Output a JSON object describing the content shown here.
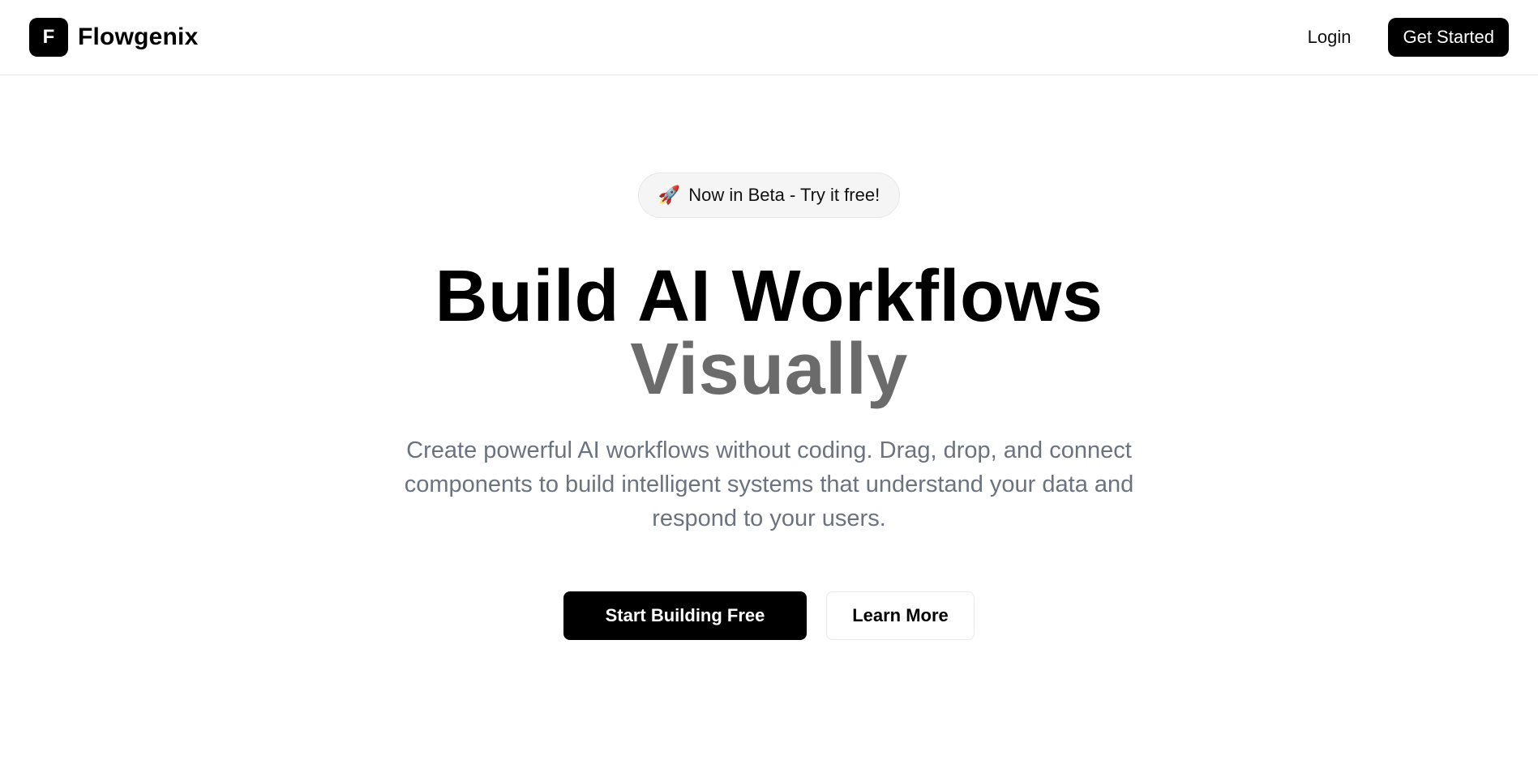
{
  "navbar": {
    "logo_letter": "F",
    "brand_name": "Flowgenix",
    "login_label": "Login",
    "get_started_label": "Get Started"
  },
  "hero": {
    "badge_icon": "rocket-icon",
    "badge_emoji": "🚀",
    "badge_text": "Now in Beta - Try it free!",
    "headline_line1": "Build AI Workflows",
    "headline_line2": "Visually",
    "subtext": "Create powerful AI workflows without coding. Drag, drop, and connect components to build intelligent systems that understand your data and respond to your users.",
    "primary_cta": "Start Building Free",
    "secondary_cta": "Learn More"
  },
  "colors": {
    "primary": "#000000",
    "headline_accent": "#6b6b6b",
    "subtext": "#6b7280",
    "badge_bg": "#f5f5f5",
    "border": "#e5e7eb"
  }
}
